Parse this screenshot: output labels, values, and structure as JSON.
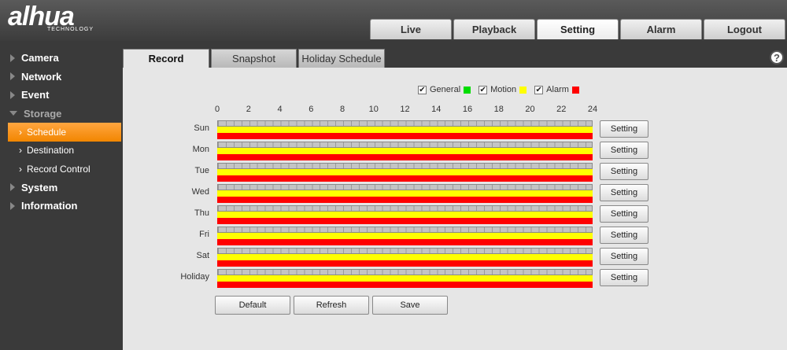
{
  "brand": {
    "name": "alhua",
    "tagline": "TECHNOLOGY"
  },
  "top_tabs": [
    {
      "label": "Live"
    },
    {
      "label": "Playback"
    },
    {
      "label": "Setting"
    },
    {
      "label": "Alarm"
    },
    {
      "label": "Logout"
    }
  ],
  "sidebar": {
    "camera": "Camera",
    "network": "Network",
    "event": "Event",
    "storage": "Storage",
    "schedule": "Schedule",
    "destination": "Destination",
    "record_control": "Record Control",
    "system": "System",
    "information": "Information"
  },
  "sub_tabs": {
    "record": "Record",
    "snapshot": "Snapshot",
    "holiday": "Holiday Schedule"
  },
  "help": "?",
  "legend": {
    "general": {
      "label": "General",
      "checked": true,
      "color": "#00dd00"
    },
    "motion": {
      "label": "Motion",
      "checked": true,
      "color": "#ffff00"
    },
    "alarm": {
      "label": "Alarm",
      "checked": true,
      "color": "#ff0000"
    },
    "checkmark": "✔"
  },
  "hours": [
    "0",
    "2",
    "4",
    "6",
    "8",
    "10",
    "12",
    "14",
    "16",
    "18",
    "20",
    "22",
    "24"
  ],
  "days": [
    {
      "label": "Sun",
      "button": "Setting"
    },
    {
      "label": "Mon",
      "button": "Setting"
    },
    {
      "label": "Tue",
      "button": "Setting"
    },
    {
      "label": "Wed",
      "button": "Setting"
    },
    {
      "label": "Thu",
      "button": "Setting"
    },
    {
      "label": "Fri",
      "button": "Setting"
    },
    {
      "label": "Sat",
      "button": "Setting"
    },
    {
      "label": "Holiday",
      "button": "Setting"
    }
  ],
  "actions": {
    "default": "Default",
    "refresh": "Refresh",
    "save": "Save"
  }
}
